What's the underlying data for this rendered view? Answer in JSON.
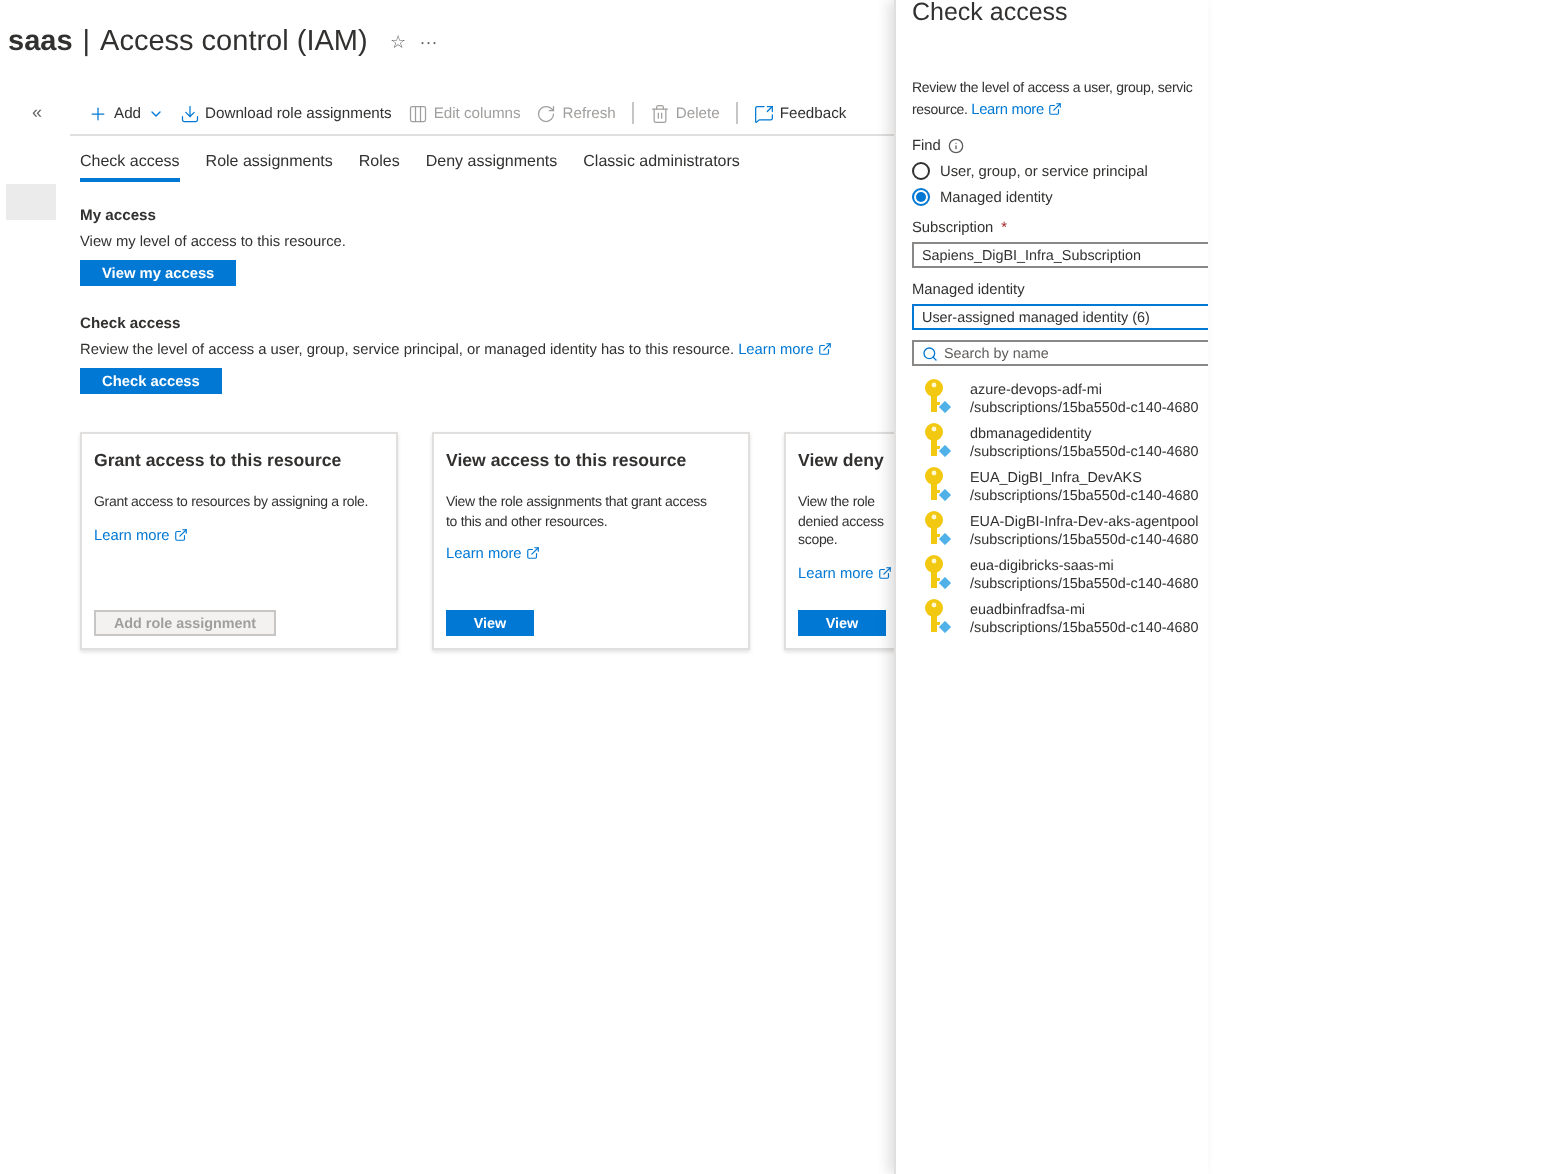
{
  "page": {
    "resource": "saas",
    "separator": "|",
    "title": "Access control (IAM)",
    "favorite_icon": "☆",
    "more": "···"
  },
  "sidebar": {
    "collapse": "«"
  },
  "toolbar": [
    {
      "kind": "add",
      "label": "Add",
      "disabled": false
    },
    {
      "kind": "download",
      "label": "Download role assignments",
      "disabled": false
    },
    {
      "kind": "columns",
      "label": "Edit columns",
      "disabled": true
    },
    {
      "kind": "refresh",
      "label": "Refresh",
      "disabled": true
    },
    {
      "kind": "divider"
    },
    {
      "kind": "delete",
      "label": "Delete",
      "disabled": true
    },
    {
      "kind": "divider"
    },
    {
      "kind": "feedback",
      "label": "Feedback",
      "disabled": false
    }
  ],
  "tabs": [
    {
      "label": "Check access",
      "selected": true
    },
    {
      "label": "Role assignments",
      "selected": false
    },
    {
      "label": "Roles",
      "selected": false
    },
    {
      "label": "Deny assignments",
      "selected": false
    },
    {
      "label": "Classic administrators",
      "selected": false
    }
  ],
  "sections": [
    {
      "heading": "My access",
      "description": "View my level of access to this resource.",
      "button": "View my access"
    },
    {
      "heading": "Check access",
      "description": "Review the level of access a user, group, service principal, or managed identity has to this resource.",
      "link": "Learn more",
      "button": "Check access"
    }
  ],
  "cards": [
    {
      "title": "Grant access to this resource",
      "description_lines": [
        "Grant access to resources by assigning a role."
      ],
      "link": "Learn more",
      "button": "Add role assignment",
      "disabled": true
    },
    {
      "title": "View access to this resource",
      "description_lines": [
        "View the role assignments that grant access",
        "to this and other resources."
      ],
      "link": "Learn more",
      "button": "View",
      "disabled": false
    },
    {
      "title": "View deny",
      "description_lines": [
        "View the role",
        "denied access",
        "scope."
      ],
      "link": "Learn more",
      "button": "View",
      "disabled": false
    }
  ],
  "panel": {
    "title": "Check access",
    "description_lines": [
      "Review the level of access a user, group, servic",
      "resource."
    ],
    "link": "Learn more",
    "find_label": "Find",
    "find_options": [
      {
        "label": "User, group, or service principal",
        "selected": false
      },
      {
        "label": "Managed identity",
        "selected": true
      }
    ],
    "subscription_label": "Subscription",
    "required_mark": "*",
    "subscription_value": "Sapiens_DigBI_Infra_Subscription",
    "identity_label": "Managed identity",
    "identity_value": "User-assigned managed identity (6)",
    "search_placeholder": "Search by name",
    "identities": [
      {
        "name": "azure-devops-adf-mi",
        "path": "/subscriptions/15ba550d-c140-4680"
      },
      {
        "name": "dbmanagedidentity",
        "path": "/subscriptions/15ba550d-c140-4680"
      },
      {
        "name": "EUA_DigBI_Infra_DevAKS",
        "path": "/subscriptions/15ba550d-c140-4680"
      },
      {
        "name": "EUA-DigBI-Infra-Dev-aks-agentpool",
        "path": "/subscriptions/15ba550d-c140-4680"
      },
      {
        "name": "eua-digibricks-saas-mi",
        "path": "/subscriptions/15ba550d-c140-4680"
      },
      {
        "name": "euadbinfradfsa-mi",
        "path": "/subscriptions/15ba550d-c140-4680"
      }
    ]
  }
}
